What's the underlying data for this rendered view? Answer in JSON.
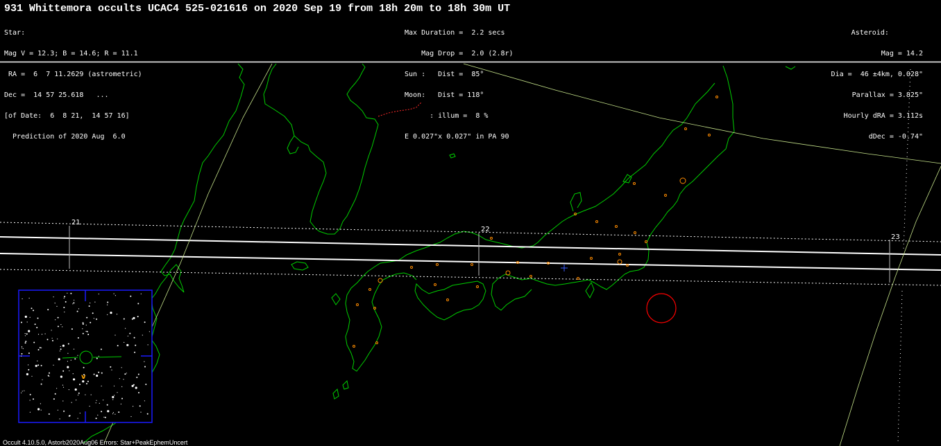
{
  "title": "931 Whittemora occults UCAC4 525-021616 on 2020 Sep 19 from 18h 20m to 18h 30m UT",
  "star_block": [
    "Star:",
    "Mag V = 12.3; B = 14.6; R = 11.1",
    " RA =  6  7 11.2629 (astrometric)",
    "Dec =  14 57 25.618   ...",
    "[of Date:  6  8 21,  14 57 16]",
    "  Prediction of 2020 Aug  6.0"
  ],
  "event_block": [
    "Max Duration =  2.2 secs",
    "    Mag Drop =  2.0 (2.8r)",
    "Sun :   Dist =  85°",
    "Moon:   Dist = 118°",
    "      : illum =  8 %",
    "E 0.027\"x 0.027\" in PA 90"
  ],
  "asteroid_block": {
    "header": "Asteroid:",
    "lines": [
      "Mag = 14.2",
      "Dia =  46 ±4km, 0.028\"",
      "Parallax = 3.825\"",
      "Hourly dRA = 3.112s",
      "dDec = -0.74\""
    ]
  },
  "time_labels": [
    "21",
    "22",
    "23"
  ],
  "footer": "Occult 4.10.5.0, Astorb2020Aug06  Errors: Star+PeakEphemUncert",
  "star_chart": {
    "target_marker": "v"
  },
  "colors": {
    "background": "#000000",
    "coastline": "#00d000",
    "border": "#ff2a2a",
    "path_center": "#ffffff",
    "path_limits": "#ffffff",
    "track_line": "#c8e68c",
    "city": "#ff8c00",
    "chart_frame": "#1a1aff",
    "antipode": "#ff0000",
    "target": "#ffa500"
  }
}
